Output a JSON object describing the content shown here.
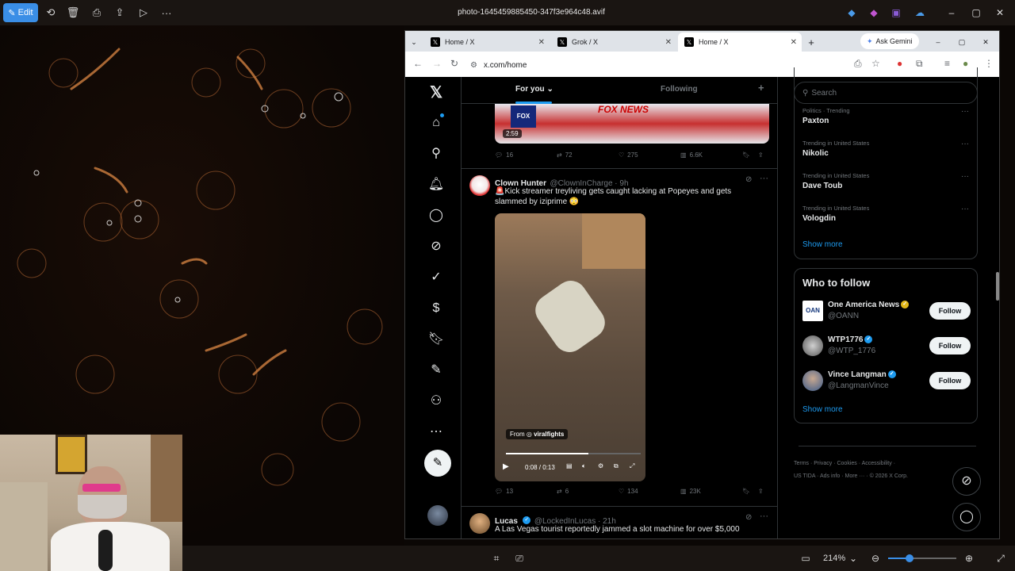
{
  "photos_app": {
    "edit_label": "Edit",
    "file_title": "photo-1645459885450-347f3e964c48.avif",
    "zoom_level": "214%"
  },
  "browser": {
    "tabs": [
      {
        "label": "Home / X"
      },
      {
        "label": "Grok / X"
      },
      {
        "label": "Home / X"
      }
    ],
    "ask_gemini": "Ask Gemini",
    "url": "x.com/home"
  },
  "x": {
    "feed_tabs": {
      "for_you": "For you",
      "following": "Following"
    },
    "tweet_top": {
      "video_time": "2:59",
      "replies": "16",
      "reposts": "72",
      "likes": "275",
      "views": "6.6K"
    },
    "tweet_main": {
      "name": "Clown Hunter",
      "handle": "@ClownInCharge · 9h",
      "text": "🚨Kick streamer treyliving gets caught lacking at Popeyes and gets slammed by iziprime 😳",
      "from_label": "From",
      "from_account": "viralfights",
      "video_progress": "0:08 / 0:13",
      "replies": "13",
      "reposts": "6",
      "likes": "134",
      "views": "23K"
    },
    "tweet_next": {
      "name": "Lucas",
      "handle": "@LockedInLucas · 21h",
      "text": "A Las Vegas tourist reportedly jammed a slot machine for over $5,000"
    },
    "search_placeholder": "Search",
    "trends": [
      {
        "meta": "Politics · Trending",
        "name": "Paxton"
      },
      {
        "meta": "Trending in United States",
        "name": "Nikolic"
      },
      {
        "meta": "Trending in United States",
        "name": "Dave Toub"
      },
      {
        "meta": "Trending in United States",
        "name": "Vologdin"
      }
    ],
    "trends_show_more": "Show more",
    "who_to_follow": {
      "title": "Who to follow",
      "accounts": [
        {
          "name": "One America News",
          "handle": "@OANN",
          "badge_color": "#e2b719"
        },
        {
          "name": "WTP1776",
          "handle": "@WTP_1776",
          "badge_color": "#1d9bf0"
        },
        {
          "name": "Vince Langman",
          "handle": "@LangmanVince",
          "badge_color": "#1d9bf0"
        }
      ],
      "follow_label": "Follow",
      "show_more": "Show more"
    },
    "footer": {
      "terms": "Terms",
      "privacy": "Privacy",
      "cookies": "Cookies",
      "accessibility": "Accessibility",
      "us_tida": "US TIDA",
      "ads_info": "Ads info",
      "more": "More ···",
      "copyright": "© 2026 X Corp."
    }
  },
  "colors": {
    "accent": "#1d9bf0",
    "edit_button": "#3a8ee6",
    "background": "#000000"
  }
}
